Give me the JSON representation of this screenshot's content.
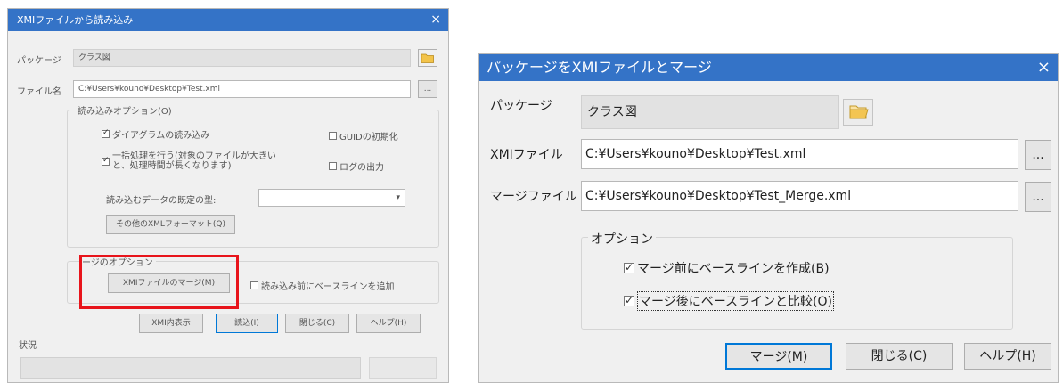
{
  "left_dialog": {
    "title": "XMIファイルから読み込み",
    "close_glyph": "×",
    "package_label": "パッケージ",
    "package_value": "クラス図",
    "file_label": "ファイル名",
    "file_value": "C:¥Users¥kouno¥Desktop¥Test.xml",
    "browse_label": "...",
    "import_options_label": "読み込みオプション(O)",
    "cb_import_diagrams": "ダイアグラムの読み込み",
    "cb_strip_guid": "GUIDの初期化",
    "cb_batch_line1": "一括処理を行う(対象のファイルが大きい",
    "cb_batch_line2": "と、処理時間が長くなります)",
    "cb_log_output": "ログの出力",
    "default_type_label": "読み込むデータの既定の型:",
    "other_xml_button": "その他のXMLフォーマット(Q)",
    "merge_options_label": "ージのオプション",
    "merge_xmi_button": "XMIファイルのマージ(M)",
    "cb_baseline_before": "読み込み前にベースラインを追加",
    "xmi_display_button": "XMI内表示",
    "import_button": "読込(I)",
    "close_button": "閉じる(C)",
    "help_button": "ヘルプ(H)",
    "status_label": "状況",
    "highlight_color": "#e8141b"
  },
  "right_dialog": {
    "title": "パッケージをXMIファイルとマージ",
    "close_glyph": "×",
    "package_label": "パッケージ",
    "package_value": "クラス図",
    "xmi_file_label": "XMIファイル",
    "xmi_file_value": "C:¥Users¥kouno¥Desktop¥Test.xml",
    "merge_file_label": "マージファイル",
    "merge_file_value": "C:¥Users¥kouno¥Desktop¥Test_Merge.xml",
    "browse_label": "...",
    "options_label": "オプション",
    "cb_baseline_before": "マージ前にベースラインを作成(B)",
    "cb_compare_after": "マージ後にベースラインと比較(O)",
    "merge_button": "マージ(M)",
    "close_button": "閉じる(C)",
    "help_button": "ヘルプ(H)",
    "titlebar_color": "#3473c7",
    "folder_icon": "folder-open-icon"
  }
}
